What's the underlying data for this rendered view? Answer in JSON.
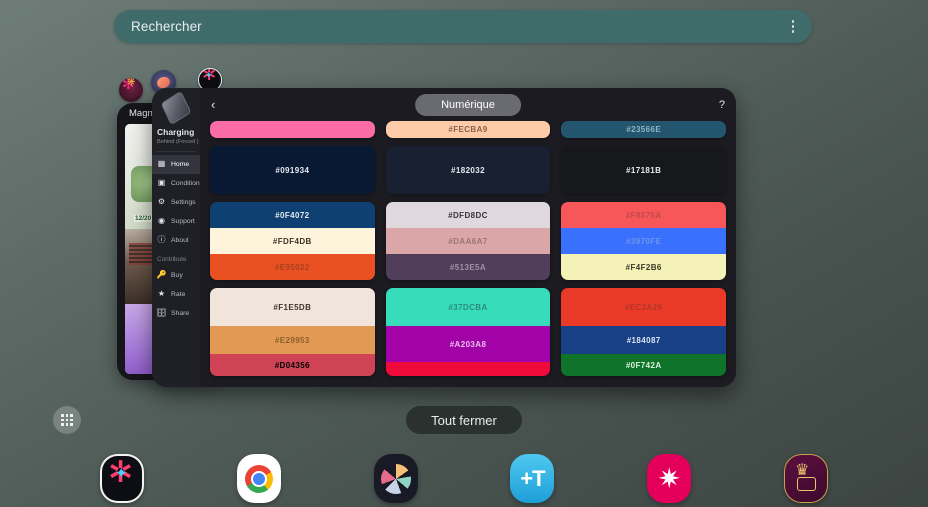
{
  "search": {
    "placeholder": "Rechercher",
    "menu_icon": "kebab-menu-icon"
  },
  "task_chips": [
    {
      "name": "flower-app-icon"
    },
    {
      "name": "lens-app-icon"
    },
    {
      "name": "gallery-app-icon"
    }
  ],
  "photos_window": {
    "title": "Magn",
    "photo_date": "12/20",
    "badge_icon": "shopping-bag-icon"
  },
  "palette_window": {
    "back_icon": "chevron-left-icon",
    "category": "Numérique",
    "help_icon": "question-mark-icon",
    "sidebar": {
      "app_name": "Charging",
      "app_sub": "Behind (Forced )",
      "nav": [
        {
          "label": "Home",
          "icon": "home-grid-icon",
          "active": true
        },
        {
          "label": "Condition",
          "icon": "condition-icon",
          "active": false
        },
        {
          "label": "Settings",
          "icon": "gear-icon",
          "active": false
        },
        {
          "label": "Support",
          "icon": "support-icon",
          "active": false
        },
        {
          "label": "About",
          "icon": "info-icon",
          "active": false
        }
      ],
      "contribute_label": "Contribute",
      "contribute": [
        {
          "label": "Buy",
          "icon": "key-icon"
        },
        {
          "label": "Rate",
          "icon": "star-icon"
        },
        {
          "label": "Share",
          "icon": "share-icon"
        }
      ]
    },
    "rows": [
      {
        "cards": [
          {
            "swatches": [
              {
                "hex": "#FB6BA5",
                "label": "",
                "text": "#7A2B4E",
                "h": 17
              }
            ]
          },
          {
            "swatches": [
              {
                "hex": "#FECBA9",
                "label": "#FECBA9",
                "text": "#8A6248",
                "h": 17
              }
            ]
          },
          {
            "swatches": [
              {
                "hex": "#23566E",
                "label": "#23566E",
                "text": "#8FB4C4",
                "h": 17
              }
            ]
          }
        ]
      },
      {
        "cards": [
          {
            "swatches": [
              {
                "hex": "#091934",
                "label": "#091934",
                "text": "#E8EAF0",
                "h": 48
              }
            ]
          },
          {
            "swatches": [
              {
                "hex": "#182032",
                "label": "#182032",
                "text": "#E8EAF0",
                "h": 48
              }
            ]
          },
          {
            "swatches": [
              {
                "hex": "#17181B",
                "label": "#17181B",
                "text": "#E8EAF0",
                "h": 48
              }
            ]
          }
        ]
      },
      {
        "cards": [
          {
            "swatches": [
              {
                "hex": "#0F4072",
                "label": "#0F4072",
                "text": "#E3EAF2",
                "h": 26
              },
              {
                "hex": "#FDF4DB",
                "label": "#FDF4DB",
                "text": "#3A3528",
                "h": 26
              },
              {
                "hex": "#E95022",
                "label": "#E95022",
                "text": "#A8421F",
                "h": 26
              }
            ]
          },
          {
            "swatches": [
              {
                "hex": "#DFD8DC",
                "label": "#DFD8DC",
                "text": "#3A3438",
                "h": 26
              },
              {
                "hex": "#DAA6A7",
                "label": "#DAA6A7",
                "text": "#9E7374",
                "h": 26
              },
              {
                "hex": "#513E5A",
                "label": "#513E5A",
                "text": "#A093A8",
                "h": 26
              }
            ]
          },
          {
            "swatches": [
              {
                "hex": "#F8575A",
                "label": "#F8575A",
                "text": "#C2484C",
                "h": 26
              },
              {
                "hex": "#3970FE",
                "label": "#3970FE",
                "text": "#6E95E8",
                "h": 26
              },
              {
                "hex": "#F4F2B6",
                "label": "#F4F2B6",
                "text": "#3A3828",
                "h": 26
              }
            ]
          }
        ]
      },
      {
        "cards": [
          {
            "swatches": [
              {
                "hex": "#F1E5DB",
                "label": "#F1E5DB",
                "text": "#3A342E",
                "h": 38
              },
              {
                "hex": "#E29953",
                "label": "#E29953",
                "text": "#8C5F2E",
                "h": 28
              },
              {
                "hex": "#D04356",
                "label": "#D04356",
                "text": "#A3success",
                "h": 22
              }
            ]
          },
          {
            "swatches": [
              {
                "hex": "#37DCBA",
                "label": "#37DCBA",
                "text": "#2A8C76",
                "h": 38
              },
              {
                "hex": "#A203A8",
                "label": "#A203A8",
                "text": "#E8C0EA",
                "h": 36
              },
              {
                "hex": "#F00A3C",
                "label": "",
                "text": "#FFFFFF",
                "h": 14
              }
            ]
          },
          {
            "swatches": [
              {
                "hex": "#EC3A29",
                "label": "#EC3A29",
                "text": "#B03526",
                "h": 38
              },
              {
                "hex": "#184087",
                "label": "#184087",
                "text": "#DDE4F2",
                "h": 28
              },
              {
                "hex": "#0F742A",
                "label": "#0F742A",
                "text": "#DDEFE0",
                "h": 22
              }
            ]
          }
        ]
      }
    ]
  },
  "controls": {
    "apps_grid_icon": "apps-grid-icon",
    "close_all": "Tout fermer"
  },
  "dock": [
    {
      "name": "dock-gallery",
      "label": "Gallery"
    },
    {
      "name": "dock-chrome",
      "label": "Chrome"
    },
    {
      "name": "dock-palette",
      "label": "Palette"
    },
    {
      "name": "dock-text",
      "label": "Text"
    },
    {
      "name": "dock-flower",
      "label": "Flower"
    },
    {
      "name": "dock-crown",
      "label": "Crown"
    }
  ]
}
